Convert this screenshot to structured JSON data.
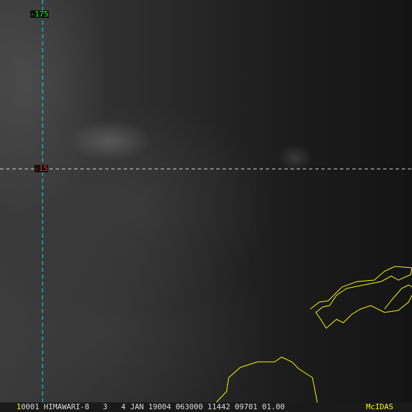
{
  "labels": {
    "longitude": "-175",
    "latitude": "-15"
  },
  "footer": {
    "frame_number": "1",
    "info": "0001 HIMAWARI-8   3   4 JAN 19004 063000 11442 09701 01.00",
    "brand": "McIDAS"
  },
  "colors": {
    "longitude_line": "#00e5ff",
    "latitude_line": "#ffffff",
    "coast": "#ffff00",
    "lon_label": "#00ff00",
    "lat_label": "#ff0000"
  }
}
